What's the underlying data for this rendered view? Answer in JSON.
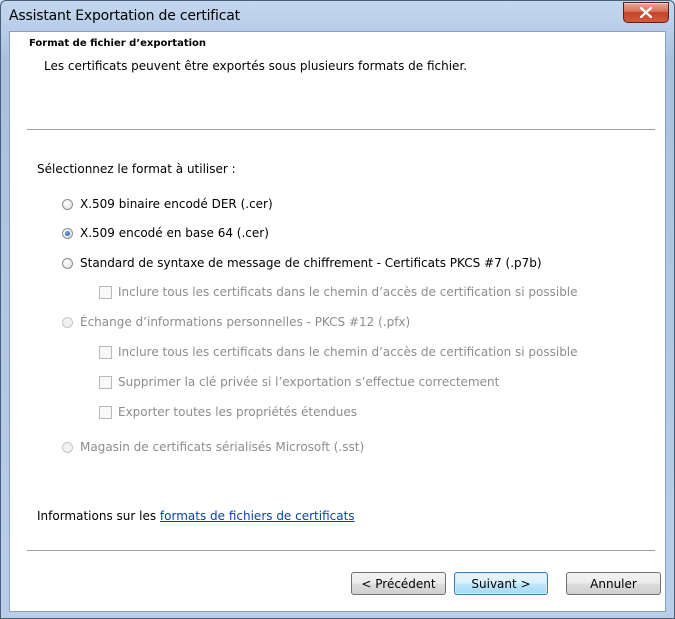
{
  "window": {
    "title": "Assistant Exportation de certificat"
  },
  "header": {
    "title": "Format de fichier d’exportation",
    "subtitle": "Les certificats peuvent être exportés sous plusieurs formats de fichier."
  },
  "form": {
    "prompt": "Sélectionnez le format à utiliser :",
    "options": [
      {
        "label": "X.509 binaire encodé DER (.cer)",
        "checked": false,
        "enabled": true
      },
      {
        "label": "X.509 encodé en base 64 (.cer)",
        "checked": true,
        "enabled": true
      },
      {
        "label": "Standard de syntaxe de message de chiffrement - Certificats PKCS #7 (.p7b)",
        "checked": false,
        "enabled": true
      },
      {
        "label": "Inclure tous les certificats dans le chemin d’accès de certification si possible",
        "checked": false,
        "enabled": false
      },
      {
        "label": "Échange d’informations personnelles - PKCS #12 (.pfx)",
        "checked": false,
        "enabled": false
      },
      {
        "label": "Inclure tous les certificats dans le chemin d’accès de certification si possible",
        "checked": false,
        "enabled": false
      },
      {
        "label": "Supprimer la clé privée si l’exportation s’effectue correctement",
        "checked": false,
        "enabled": false
      },
      {
        "label": "Exporter toutes les propriétés étendues",
        "checked": false,
        "enabled": false
      },
      {
        "label": "Magasin de certificats sérialisés Microsoft (.sst)",
        "checked": false,
        "enabled": false
      }
    ]
  },
  "info": {
    "prefix": "Informations sur les ",
    "link": "formats de fichiers de certificats"
  },
  "buttons": {
    "back": "< Précédent",
    "next": "Suivant >",
    "cancel": "Annuler"
  },
  "colors": {
    "link": "#0645ad",
    "default_button_border": "#3c7fb1",
    "close_button": "#c3432a"
  }
}
